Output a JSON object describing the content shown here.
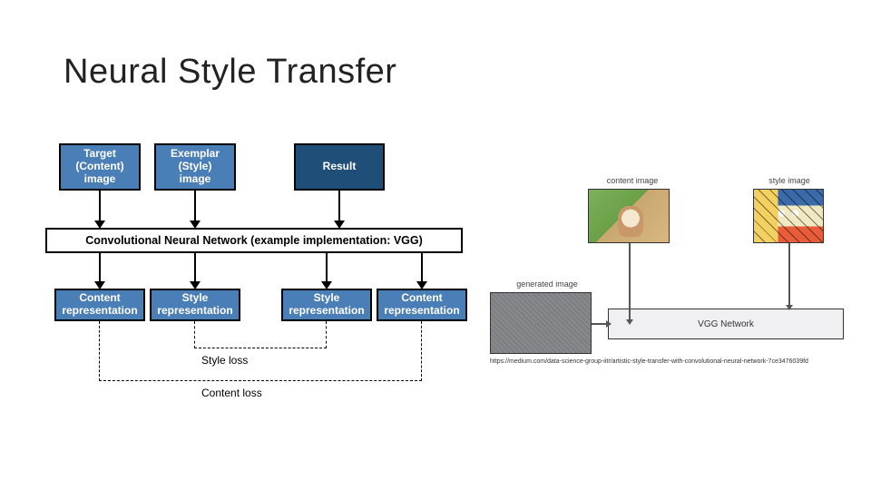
{
  "title": "Neural Style Transfer",
  "diagram": {
    "target_box": "Target\n(Content)\nimage",
    "exemplar_box": "Exemplar\n(Style)\nimage",
    "result_box": "Result",
    "cnn_box": "Convolutional Neural Network (example implementation: VGG)",
    "content_rep": "Content\nrepresentation",
    "style_rep": "Style\nrepresentation",
    "style_loss": "Style loss",
    "content_loss": "Content loss"
  },
  "illustration": {
    "content_image_label": "content image",
    "style_image_label": "style image",
    "generated_image_label": "generated image",
    "vgg_label": "VGG Network"
  },
  "citation": "https://medium.com/data-science-group-iitr/artistic-style-transfer-with-convolutional-neural-network-7ce3476039fd"
}
